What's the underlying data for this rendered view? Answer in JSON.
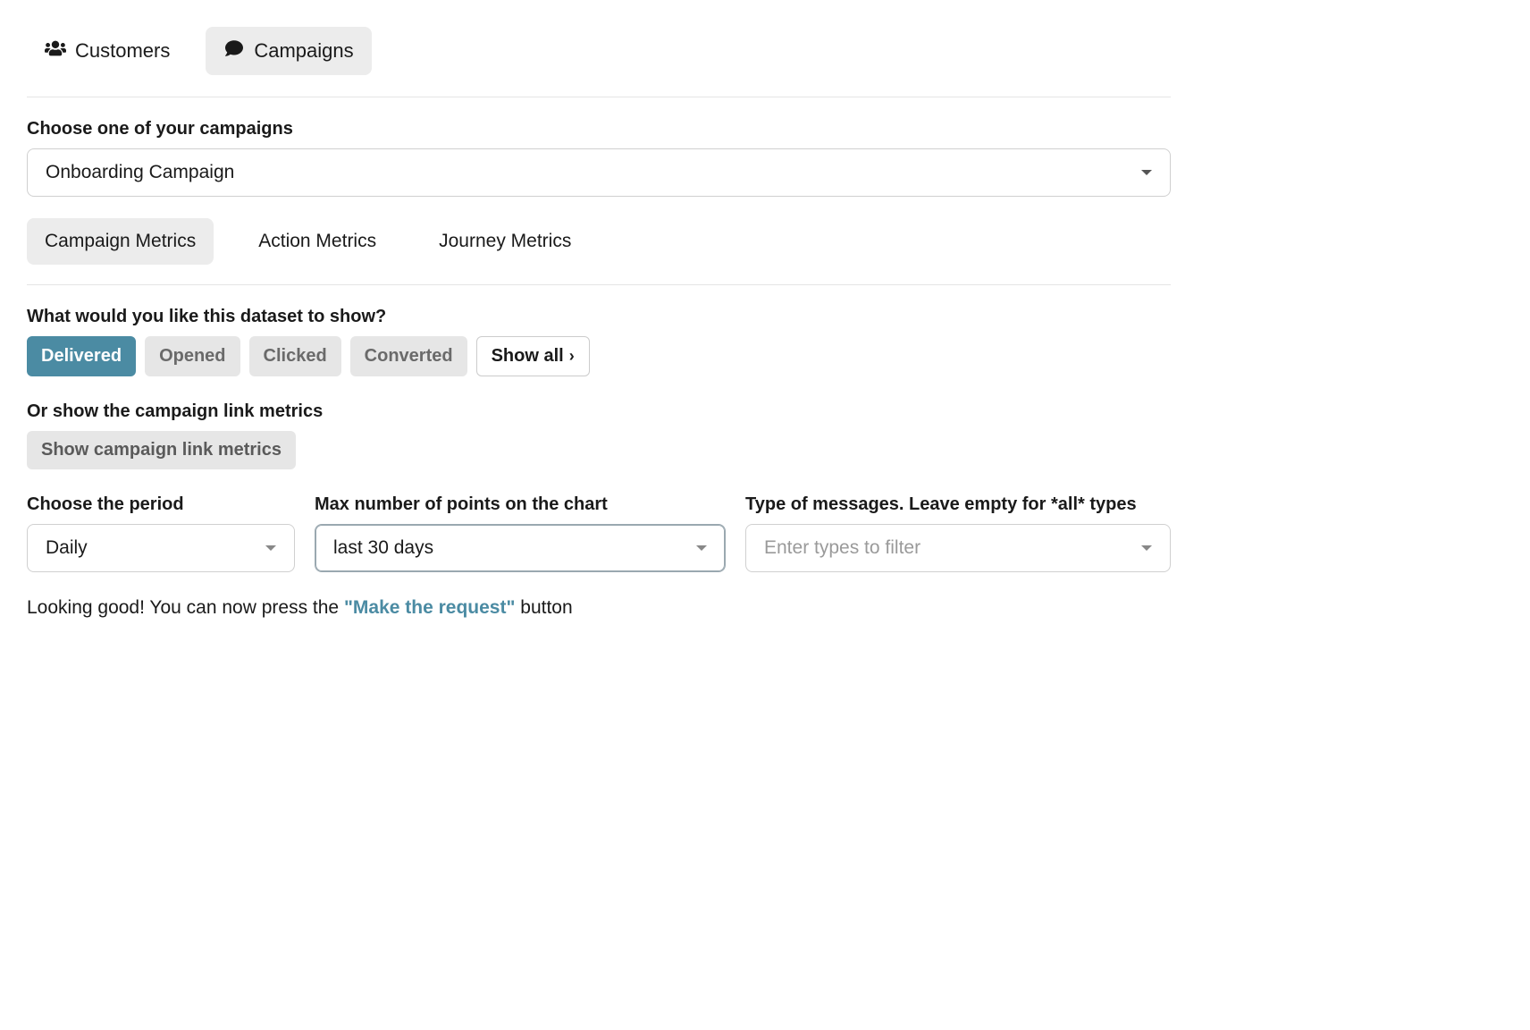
{
  "topTabs": {
    "customers": "Customers",
    "campaigns": "Campaigns"
  },
  "labels": {
    "chooseCampaign": "Choose one of your campaigns",
    "datasetQuestion": "What would you like this dataset to show?",
    "orLinkMetrics": "Or show the campaign link metrics",
    "choosePeriod": "Choose the period",
    "maxPoints": "Max number of points on the chart",
    "typeOfMessages": "Type of messages. Leave empty for *all* types"
  },
  "campaignSelect": {
    "value": "Onboarding Campaign"
  },
  "metricsTabs": {
    "campaign": "Campaign Metrics",
    "action": "Action Metrics",
    "journey": "Journey Metrics"
  },
  "datasetPills": {
    "delivered": "Delivered",
    "opened": "Opened",
    "clicked": "Clicked",
    "converted": "Converted",
    "showAll": "Show all"
  },
  "linkMetricsButton": "Show campaign link metrics",
  "periodSelect": {
    "value": "Daily"
  },
  "pointsSelect": {
    "value": "last 30 days"
  },
  "typesSelect": {
    "placeholder": "Enter types to filter"
  },
  "hint": {
    "prefix": "Looking good! You can now press the ",
    "emph": "\"Make the request\"",
    "suffix": " button"
  }
}
